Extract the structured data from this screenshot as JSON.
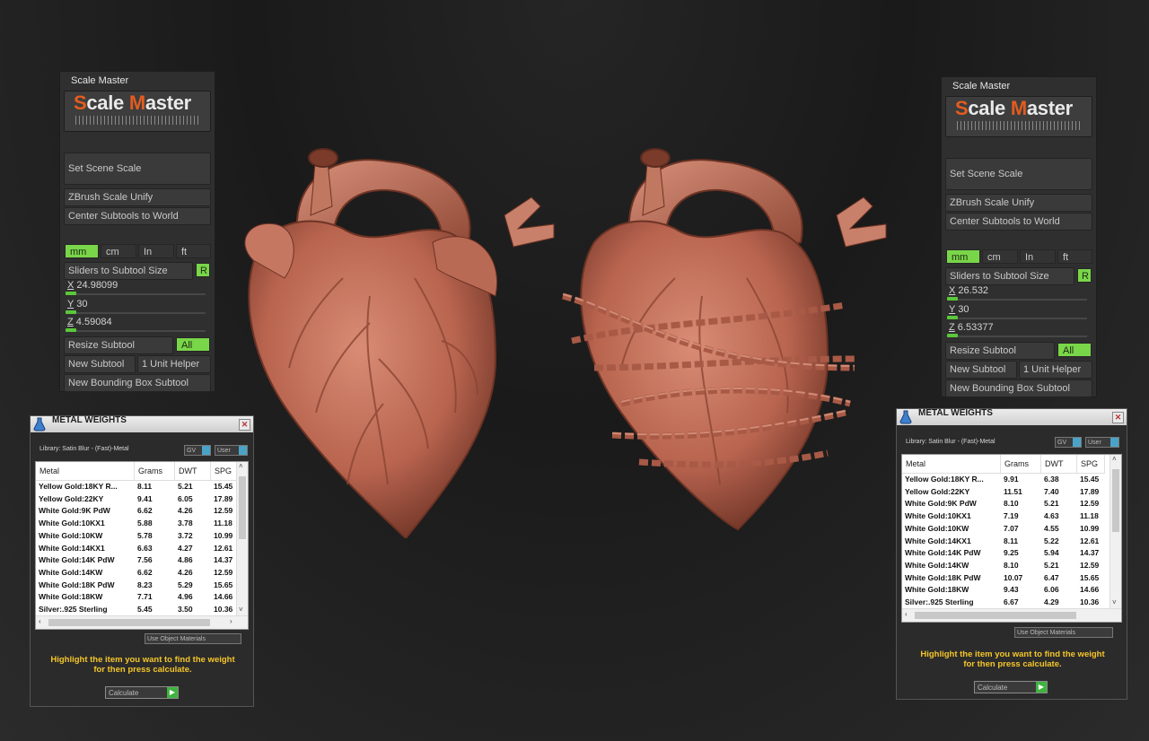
{
  "left": {
    "scale_master": {
      "title": "Scale Master",
      "logo_a": "S",
      "logo_b": "cale ",
      "logo_c": "M",
      "logo_d": "aster",
      "set_scene_scale": "Set Scene Scale",
      "zbrush_scale_unify": "ZBrush Scale Unify",
      "center_subtools": "Center Subtools to World",
      "units": [
        "mm",
        "cm",
        "In",
        "ft"
      ],
      "active_unit": "mm",
      "sliders_to_subtool_size": "Sliders to Subtool Size",
      "r_label": "R",
      "x_label": "X",
      "x_value": "24.98099",
      "y_label": "Y",
      "y_value": "30",
      "z_label": "Z",
      "z_value": "4.59084",
      "resize_subtool": "Resize Subtool",
      "all_label": "All",
      "new_subtool": "New Subtool",
      "unit_helper": "1 Unit Helper",
      "new_bounding_box": "New Bounding Box Subtool"
    },
    "metal_weights": {
      "title": "METAL WEIGHTS",
      "library": "Library: Satin Blur - (Fast)-Metal",
      "sel1": "GV",
      "sel2": "User",
      "columns": [
        "Metal",
        "Grams",
        "DWT",
        "SPG"
      ],
      "rows": [
        [
          "Yellow Gold:18KY R...",
          "8.11",
          "5.21",
          "15.45"
        ],
        [
          "Yellow Gold:22KY",
          "9.41",
          "6.05",
          "17.89"
        ],
        [
          "White Gold:9K PdW",
          "6.62",
          "4.26",
          "12.59"
        ],
        [
          "White Gold:10KX1",
          "5.88",
          "3.78",
          "11.18"
        ],
        [
          "White Gold:10KW",
          "5.78",
          "3.72",
          "10.99"
        ],
        [
          "White Gold:14KX1",
          "6.63",
          "4.27",
          "12.61"
        ],
        [
          "White Gold:14K PdW",
          "7.56",
          "4.86",
          "14.37"
        ],
        [
          "White Gold:14KW",
          "6.62",
          "4.26",
          "12.59"
        ],
        [
          "White Gold:18K PdW",
          "8.23",
          "5.29",
          "15.65"
        ],
        [
          "White Gold:18KW",
          "7.71",
          "4.96",
          "14.66"
        ],
        [
          "Silver:.925 Sterling",
          "5.45",
          "3.50",
          "10.36"
        ]
      ],
      "use_object_materials": "Use Object Materials",
      "hint_line1": "Highlight the item you want to find the weight",
      "hint_line2": "for then press calculate.",
      "calculate": "Calculate"
    }
  },
  "right": {
    "scale_master": {
      "title": "Scale Master",
      "logo_a": "S",
      "logo_b": "cale ",
      "logo_c": "M",
      "logo_d": "aster",
      "set_scene_scale": "Set Scene Scale",
      "zbrush_scale_unify": "ZBrush Scale Unify",
      "center_subtools": "Center Subtools to World",
      "units": [
        "mm",
        "cm",
        "In",
        "ft"
      ],
      "active_unit": "mm",
      "sliders_to_subtool_size": "Sliders to Subtool Size",
      "r_label": "R",
      "x_label": "X",
      "x_value": "26.532",
      "y_label": "Y",
      "y_value": "30",
      "z_label": "Z",
      "z_value": "6.53377",
      "resize_subtool": "Resize Subtool",
      "all_label": "All",
      "new_subtool": "New Subtool",
      "unit_helper": "1 Unit Helper",
      "new_bounding_box": "New Bounding Box Subtool"
    },
    "metal_weights": {
      "title": "METAL WEIGHTS",
      "library": "Library: Satin Blur - (Fast)-Metal",
      "sel1": "GV",
      "sel2": "User",
      "columns": [
        "Metal",
        "Grams",
        "DWT",
        "SPG"
      ],
      "rows": [
        [
          "Yellow Gold:18KY R...",
          "9.91",
          "6.38",
          "15.45"
        ],
        [
          "Yellow Gold:22KY",
          "11.51",
          "7.40",
          "17.89"
        ],
        [
          "White Gold:9K PdW",
          "8.10",
          "5.21",
          "12.59"
        ],
        [
          "White Gold:10KX1",
          "7.19",
          "4.63",
          "11.18"
        ],
        [
          "White Gold:10KW",
          "7.07",
          "4.55",
          "10.99"
        ],
        [
          "White Gold:14KX1",
          "8.11",
          "5.22",
          "12.61"
        ],
        [
          "White Gold:14K PdW",
          "9.25",
          "5.94",
          "14.37"
        ],
        [
          "White Gold:14KW",
          "8.10",
          "5.21",
          "12.59"
        ],
        [
          "White Gold:18K PdW",
          "10.07",
          "6.47",
          "15.65"
        ],
        [
          "White Gold:18KW",
          "9.43",
          "6.06",
          "14.66"
        ],
        [
          "Silver:.925 Sterling",
          "6.67",
          "4.29",
          "10.36"
        ]
      ],
      "use_object_materials": "Use Object Materials",
      "hint_line1": "Highlight the item you want to find the weight",
      "hint_line2": "for then press calculate.",
      "calculate": "Calculate"
    }
  },
  "icons": {
    "heart_plain": "anatomical-heart-model",
    "heart_chain": "anatomical-heart-with-chain-model",
    "metal_weights_icon": "flask-icon"
  },
  "colors": {
    "accent_green": "#79d649",
    "logo_orange": "#e25c1f",
    "hint_yellow": "#f5c62b",
    "heart_clay": "#c0705c"
  }
}
